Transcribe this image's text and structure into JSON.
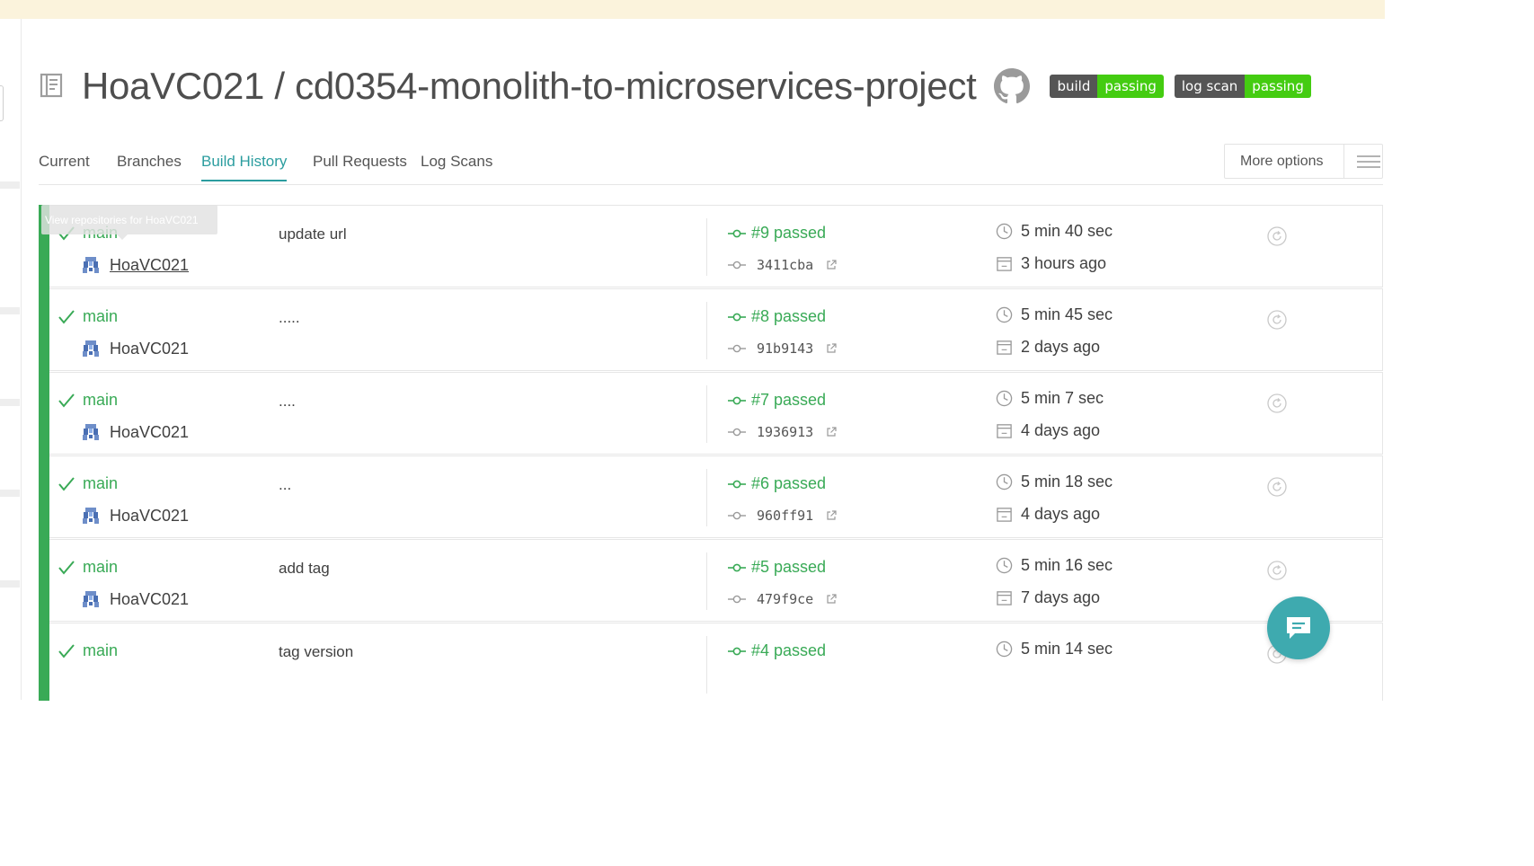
{
  "repo": {
    "title": "HoaVC021 / cd0354-monolith-to-microservices-project",
    "badges": [
      {
        "label": "build",
        "status": "passing"
      },
      {
        "label": "log scan",
        "status": "passing"
      }
    ]
  },
  "tabs": {
    "current": "Current",
    "branches": "Branches",
    "build_history": "Build History",
    "pull_requests": "Pull Requests",
    "log_scans": "Log Scans",
    "active": "Build History"
  },
  "more_options": {
    "label": "More options"
  },
  "tooltip": {
    "text": "View repositories for HoaVC021"
  },
  "colors": {
    "passed": "#39aa56",
    "accent": "#2b9d9f",
    "badge_green": "#44cc11",
    "badge_gray": "#555555",
    "chat": "#3eaaaf"
  },
  "icons": {
    "repo": "repo-book-icon",
    "github": "github-octocat-icon",
    "check": "check-icon",
    "commit": "commit-icon",
    "external": "external-link-icon",
    "clock": "clock-icon",
    "calendar": "calendar-icon",
    "restart": "restart-icon",
    "menu": "hamburger-menu-icon",
    "chat": "chat-bubble-icon"
  },
  "builds": [
    {
      "branch": "main",
      "author": "HoaVC021",
      "message": "update url",
      "number": "#9 passed",
      "commit": "3411cba",
      "duration": "5 min 40 sec",
      "finished": "3 hours ago"
    },
    {
      "branch": "main",
      "author": "HoaVC021",
      "message": ".....",
      "number": "#8 passed",
      "commit": "91b9143",
      "duration": "5 min 45 sec",
      "finished": "2 days ago"
    },
    {
      "branch": "main",
      "author": "HoaVC021",
      "message": "....",
      "number": "#7 passed",
      "commit": "1936913",
      "duration": "5 min 7 sec",
      "finished": "4 days ago"
    },
    {
      "branch": "main",
      "author": "HoaVC021",
      "message": "...",
      "number": "#6 passed",
      "commit": "960ff91",
      "duration": "5 min 18 sec",
      "finished": "4 days ago"
    },
    {
      "branch": "main",
      "author": "HoaVC021",
      "message": "add tag",
      "number": "#5 passed",
      "commit": "479f9ce",
      "duration": "5 min 16 sec",
      "finished": "7 days ago"
    },
    {
      "branch": "main",
      "author": "",
      "message": "tag version",
      "number": "#4 passed",
      "commit": "",
      "duration": "5 min 14 sec",
      "finished": ""
    }
  ]
}
